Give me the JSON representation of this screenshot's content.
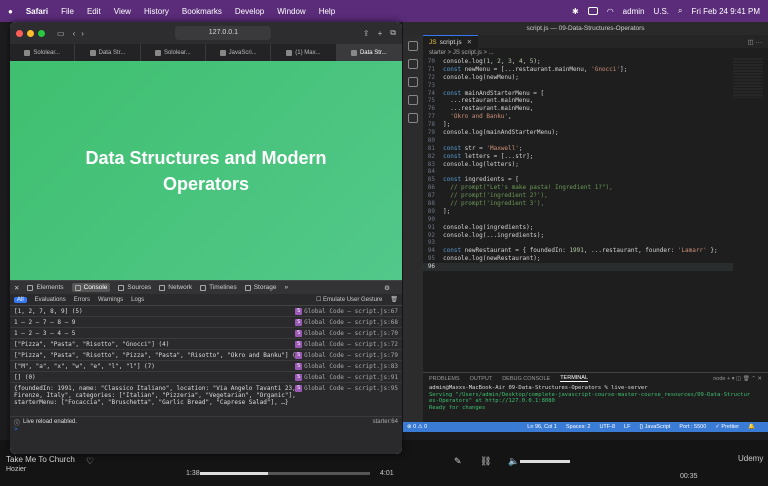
{
  "menubar": {
    "app": "Safari",
    "items": [
      "File",
      "Edit",
      "View",
      "History",
      "Bookmarks",
      "Develop",
      "Window",
      "Help"
    ],
    "user": "admin",
    "input_source": "U.S.",
    "clock": "Fri Feb 24 9:41 PM"
  },
  "safari": {
    "url": "127.0.0.1",
    "tabs": [
      "Sololear...",
      "Data Str...",
      "Sololear...",
      "JavaScri...",
      "(1) Max...",
      "Data Str..."
    ],
    "page_title": "Data Structures and Modern Operators"
  },
  "devtools": {
    "tabs": [
      "Elements",
      "Console",
      "Sources",
      "Network",
      "Timelines",
      "Storage"
    ],
    "filters": [
      "All",
      "Evaluations",
      "Errors",
      "Warnings",
      "Logs"
    ],
    "emulate": "Emulate User Gesture",
    "rows": [
      {
        "text": "[1, 2, 7, 8, 9] (5)",
        "src": "Global Code — script.js:67"
      },
      {
        "text": "1 – 2 – 7 – 8 – 9",
        "src": "Global Code — script.js:68"
      },
      {
        "text": "1 – 2 – 3 – 4 – 5",
        "src": "Global Code — script.js:70"
      },
      {
        "text": "[\"Pizza\", \"Pasta\", \"Risotto\", \"Gnocci\"] (4)",
        "src": "Global Code — script.js:72"
      },
      {
        "text": "[\"Pizza\", \"Pasta\", \"Risotto\", \"Pizza\", \"Pasta\", \"Risotto\", \"Okro and Banku\"] (7)",
        "src": "Global Code — script.js:79"
      },
      {
        "text": "[\"M\", \"a\", \"x\", \"w\", \"e\", \"l\", \"l\"] (7)",
        "src": "Global Code — script.js:83"
      },
      {
        "text": "[] (0)",
        "src": "Global Code — script.js:91"
      }
    ],
    "object_row": "{foundedIn: 1991, name: \"Classico Italiano\", location: \"Via Angelo Tavanti 23, Firenze, Italy\", categories: [\"Italian\", \"Pizzeria\", \"Vegetarian\", \"Organic\"], starterMenu: [\"Focaccia\", \"Bruschetta\", \"Garlic Bread\", \"Caprese Salad\"], …}",
    "object_src": "Global Code — script.js:95",
    "live_reload": "Live reload enabled.",
    "live_reload_src": "starter:64"
  },
  "vscode": {
    "title": "script.js — 09-Data-Structures-Operators",
    "tab": "script.js",
    "breadcrumb": "starter > JS script.js > ...",
    "lines": [
      {
        "n": "70",
        "code": "console.log(1, 2, 3, 4, 5);"
      },
      {
        "n": "71",
        "code": "const newMenu = [...restaurant.mainMenu, 'Gnocci'];"
      },
      {
        "n": "72",
        "code": "console.log(newMenu);"
      },
      {
        "n": "73",
        "code": ""
      },
      {
        "n": "74",
        "code": "const mainAndStarterMenu = ["
      },
      {
        "n": "75",
        "code": "  ...restaurant.mainMenu,"
      },
      {
        "n": "76",
        "code": "  ...restaurant.mainMenu,"
      },
      {
        "n": "77",
        "code": "  'Okro and Banku',"
      },
      {
        "n": "78",
        "code": "];"
      },
      {
        "n": "79",
        "code": "console.log(mainAndStarterMenu);"
      },
      {
        "n": "80",
        "code": ""
      },
      {
        "n": "81",
        "code": "const str = 'Maxwell';"
      },
      {
        "n": "82",
        "code": "const letters = [...str];"
      },
      {
        "n": "83",
        "code": "console.log(letters);"
      },
      {
        "n": "84",
        "code": ""
      },
      {
        "n": "85",
        "code": "const ingredients = ["
      },
      {
        "n": "86",
        "code": "  // prompt(\"Let's make pasta! Ingredient 1?\"),"
      },
      {
        "n": "87",
        "code": "  // prompt('ingredient 2?'),"
      },
      {
        "n": "88",
        "code": "  // prompt('ingredient 3'),"
      },
      {
        "n": "89",
        "code": "];"
      },
      {
        "n": "90",
        "code": ""
      },
      {
        "n": "91",
        "code": "console.log(ingredients);"
      },
      {
        "n": "92",
        "code": "console.log(...ingredients);"
      },
      {
        "n": "93",
        "code": ""
      },
      {
        "n": "94",
        "code": "const newRestaurant = { foundedIn: 1991, ...restaurant, founder: 'Lamarr' };"
      },
      {
        "n": "95",
        "code": "console.log(newRestaurant);"
      },
      {
        "n": "96",
        "code": ""
      }
    ],
    "panel_tabs": [
      "PROBLEMS",
      "OUTPUT",
      "DEBUG CONSOLE",
      "TERMINAL"
    ],
    "terminal": [
      "admin@Maxxs-MacBook-Air 09-Data-Structures-Operators % live-server",
      "Serving \"/Users/admin/Desktop/complete-javascript-course-master-course_resources/09-Data-Structur",
      "es-Operators\" at http://127.0.0.1:8080",
      "Ready for changes"
    ],
    "status": [
      "⊗ 0 ⚠ 0",
      "Ln 96, Col 1",
      "Spaces: 2",
      "UTF-8",
      "LF",
      "{} JavaScript",
      "Port : 5500",
      "✓ Prettier"
    ]
  },
  "background": {
    "track": "Take Me To Church",
    "artist": "Hozier",
    "elapsed": "1:38",
    "total": "4:01",
    "time_right": "00:35",
    "brand": "Udemy"
  }
}
